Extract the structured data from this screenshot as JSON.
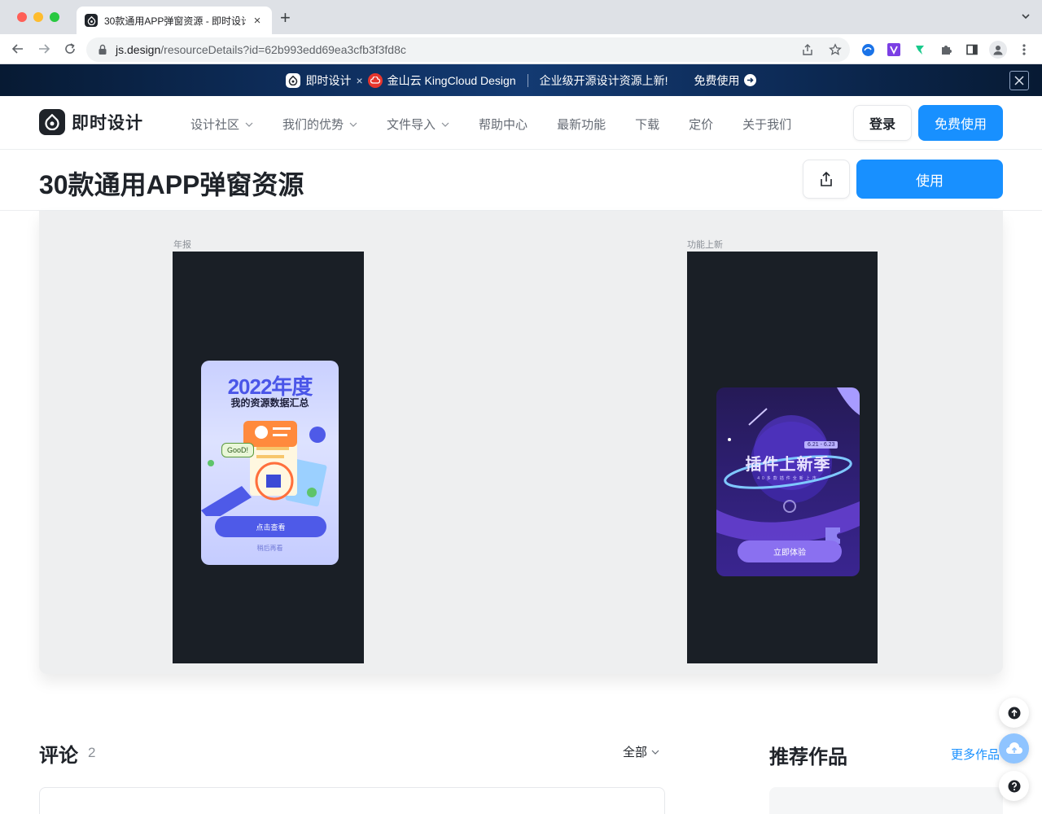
{
  "browser": {
    "tab_title": "30款通用APP弹窗资源 - 即时设计",
    "url_host": "js.design",
    "url_path": "/resourceDetails?id=62b993edd69ea3cfb3f3fd8c"
  },
  "promo": {
    "brand": "即时设计",
    "times": "×",
    "partner": "金山云 KingCloud Design",
    "message": "企业级开源设计资源上新!",
    "cta": "免费使用"
  },
  "header": {
    "brand_name": "即时设计",
    "nav": [
      {
        "label": "设计社区",
        "dropdown": true
      },
      {
        "label": "我们的优势",
        "dropdown": true
      },
      {
        "label": "文件导入",
        "dropdown": true
      },
      {
        "label": "帮助中心",
        "dropdown": false
      },
      {
        "label": "最新功能",
        "dropdown": false
      },
      {
        "label": "下载",
        "dropdown": false
      },
      {
        "label": "定价",
        "dropdown": false
      },
      {
        "label": "关于我们",
        "dropdown": false
      }
    ],
    "login_label": "登录",
    "free_label": "免费使用"
  },
  "resource": {
    "title": "30款通用APP弹窗资源",
    "use_label": "使用"
  },
  "preview": {
    "frames": [
      {
        "label": "年报",
        "card": {
          "year": "2022年度",
          "subtitle": "我的资源数据汇总",
          "bubble": "GooD!",
          "button": "点击查看",
          "later": "稍后再看"
        }
      },
      {
        "label": "功能上新",
        "card": {
          "date_badge": "6.21 - 6.23",
          "title": "插件上新季",
          "subtitle": "40多款插件全新上市",
          "button": "立即体验"
        }
      }
    ]
  },
  "comments": {
    "title": "评论",
    "count": "2",
    "filter_label": "全部"
  },
  "recommended": {
    "title": "推荐作品",
    "more_label": "更多作品"
  },
  "colors": {
    "accent": "#1890ff",
    "promo_bg": "#0d2b57",
    "frame_bg": "#1a1f26"
  }
}
